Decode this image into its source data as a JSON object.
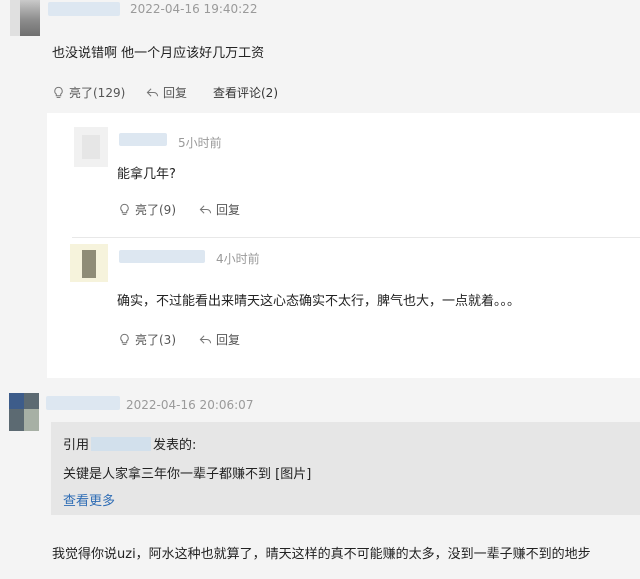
{
  "comments": [
    {
      "timestamp": "2022-04-16 19:40:22",
      "text": "也没说错啊 他一个月应该好几万工资",
      "actions": {
        "like": "亮了(129)",
        "reply": "回复",
        "view_replies": "查看评论(2)"
      },
      "replies": [
        {
          "time_ago": "5小时前",
          "text": "能拿几年?",
          "actions": {
            "like": "亮了(9)",
            "reply": "回复"
          }
        },
        {
          "time_ago": "4小时前",
          "text": "确实，不过能看出来晴天这心态确实不太行，脾气也大，一点就着。。。",
          "actions": {
            "like": "亮了(3)",
            "reply": "回复"
          }
        }
      ]
    },
    {
      "timestamp": "2022-04-16 20:06:07",
      "quote": {
        "prefix": "引用",
        "suffix": "发表的:",
        "text": "关键是人家拿三年你一辈子都赚不到 [图片]",
        "more": "查看更多"
      },
      "text": "我觉得你说uzi，阿水这种也就算了，晴天这样的真不可能赚的太多，没到一辈子赚不到的地步"
    }
  ],
  "icons": {
    "like": "lightbulb-icon",
    "reply": "reply-arrow-icon"
  },
  "colors": {
    "link": "#2f6db5",
    "meta": "#9a9a9a",
    "background": "#f4f4f4",
    "quote_bg": "#e6e6e6"
  }
}
